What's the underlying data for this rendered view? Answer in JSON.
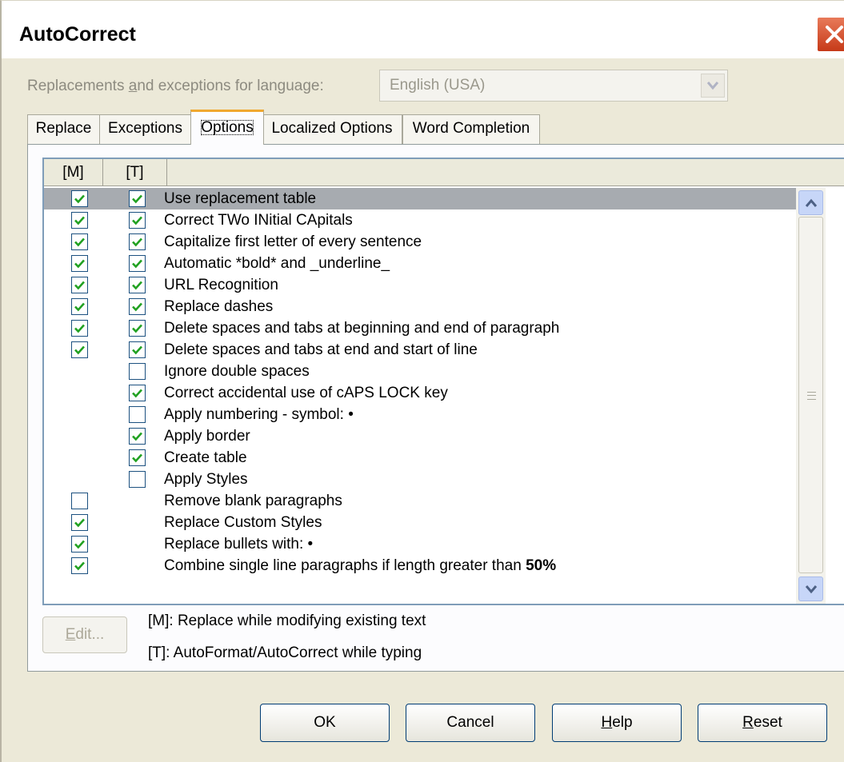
{
  "window": {
    "title": "AutoCorrect"
  },
  "language": {
    "label": "Replacements and exceptions for language:",
    "label_parts": [
      "Replacements ",
      "a",
      "nd exceptions for language:"
    ],
    "selected": "English (USA)"
  },
  "tabs": [
    {
      "label": "Replace",
      "active": false
    },
    {
      "label": "Exceptions",
      "active": false
    },
    {
      "label": "Options",
      "active": true
    },
    {
      "label": "Localized Options",
      "active": false
    },
    {
      "label": "Word Completion",
      "active": false
    }
  ],
  "table": {
    "headers": [
      "[M]",
      "[T]",
      ""
    ],
    "rows": [
      {
        "label": "Use replacement table",
        "m": true,
        "t": true,
        "selected": true
      },
      {
        "label": "Correct TWo INitial CApitals",
        "m": true,
        "t": true
      },
      {
        "label": "Capitalize first letter of every sentence",
        "m": true,
        "t": true
      },
      {
        "label": "Automatic *bold* and _underline_",
        "m": true,
        "t": true
      },
      {
        "label": "URL Recognition",
        "m": true,
        "t": true
      },
      {
        "label": "Replace dashes",
        "m": true,
        "t": true
      },
      {
        "label": "Delete spaces and tabs at beginning and end of paragraph",
        "m": true,
        "t": true
      },
      {
        "label": "Delete spaces and tabs at end and start of line",
        "m": true,
        "t": true
      },
      {
        "label": "Ignore double spaces",
        "m": null,
        "t": false
      },
      {
        "label": "Correct accidental use of cAPS LOCK key",
        "m": null,
        "t": true
      },
      {
        "label": "Apply numbering - symbol: •",
        "m": null,
        "t": false
      },
      {
        "label": "Apply border",
        "m": null,
        "t": true
      },
      {
        "label": "Create table",
        "m": null,
        "t": true
      },
      {
        "label": "Apply Styles",
        "m": null,
        "t": false
      },
      {
        "label": "Remove blank paragraphs",
        "m": false,
        "t": null
      },
      {
        "label": "Replace Custom Styles",
        "m": true,
        "t": null
      },
      {
        "label": "Replace bullets with: •",
        "m": true,
        "t": null
      },
      {
        "label": "Combine single line paragraphs if length greater than ",
        "label_bold": "50%",
        "m": true,
        "t": null
      }
    ]
  },
  "edit_button": {
    "label": "Edit...",
    "mnemonic": "E",
    "rest": "dit..."
  },
  "legend": {
    "m": "[M]: Replace while modifying existing text",
    "t": "[T]: AutoFormat/AutoCorrect while typing"
  },
  "buttons": {
    "ok": "OK",
    "cancel": "Cancel",
    "help": "Help",
    "help_mnemonic": "H",
    "help_rest": "elp",
    "reset": "Reset",
    "reset_mnemonic": "R",
    "reset_rest": "eset"
  }
}
